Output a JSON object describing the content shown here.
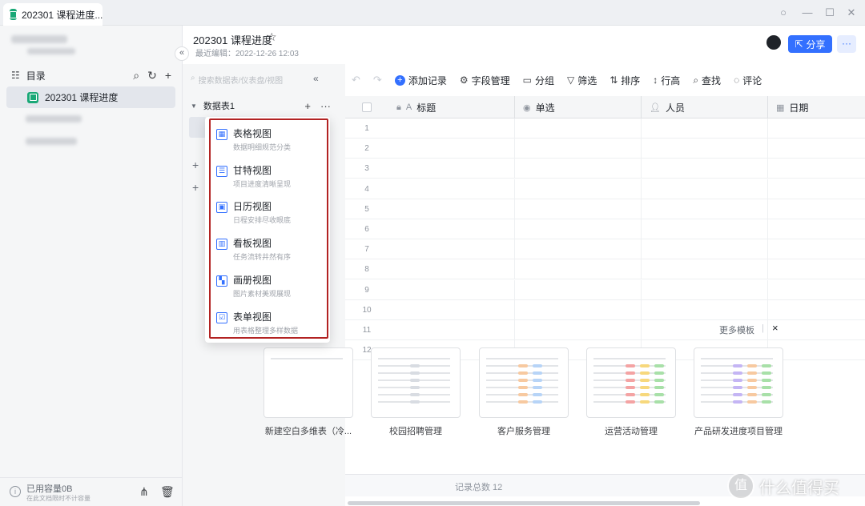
{
  "window": {
    "tab_title": "202301 课程进度...",
    "controls": [
      "minimize",
      "restore",
      "close"
    ]
  },
  "sidebar": {
    "directory_label": "目录",
    "items": [
      {
        "label": "202301 课程进度",
        "active": true
      }
    ],
    "storage_label": "已用容量0B",
    "storage_sub": "在此文档限时不计容量"
  },
  "doc": {
    "title": "202301 课程进度",
    "last_edit": "最近编辑：2022-12-26 12:03",
    "share_label": "分享",
    "more_label": "···"
  },
  "table_panel": {
    "search_placeholder": "搜索数据表/仪表盘/视图",
    "table_name": "数据表1"
  },
  "view_menu": {
    "items": [
      {
        "title": "表格视图",
        "desc": "数据明细规范分类",
        "icon": "grid-view-icon"
      },
      {
        "title": "甘特视图",
        "desc": "项目进度清晰呈现",
        "icon": "gantt-view-icon"
      },
      {
        "title": "日历视图",
        "desc": "日程安排尽收眼底",
        "icon": "calendar-view-icon"
      },
      {
        "title": "看板视图",
        "desc": "任务流转井然有序",
        "icon": "kanban-view-icon"
      },
      {
        "title": "画册视图",
        "desc": "图片素材美观展现",
        "icon": "gallery-view-icon"
      },
      {
        "title": "表单视图",
        "desc": "用表格整理多样数据",
        "icon": "form-view-icon"
      }
    ]
  },
  "toolbar": {
    "add_record": "添加记录",
    "field_manage": "字段管理",
    "group": "分组",
    "filter": "筛选",
    "sort": "排序",
    "row_height": "行高",
    "find": "查找",
    "comment": "评论"
  },
  "grid": {
    "columns": [
      {
        "label": "标题",
        "icon": "text-field-icon"
      },
      {
        "label": "单选",
        "icon": "single-select-icon"
      },
      {
        "label": "人员",
        "icon": "person-icon"
      },
      {
        "label": "日期",
        "icon": "date-icon"
      }
    ],
    "row_numbers": [
      "1",
      "2",
      "3",
      "4",
      "5",
      "6",
      "7",
      "8",
      "9",
      "10",
      "11",
      "12"
    ],
    "record_count": "记录总数 12"
  },
  "templates": {
    "more_label": "更多模板",
    "close_label": "×",
    "cards": [
      {
        "label": "新建空白多维表（冷..."
      },
      {
        "label": "校园招聘管理"
      },
      {
        "label": "客户服务管理"
      },
      {
        "label": "运营活动管理"
      },
      {
        "label": "产品研发进度项目管理"
      }
    ]
  },
  "watermark": {
    "text": "什么值得买",
    "glyph": "值"
  }
}
